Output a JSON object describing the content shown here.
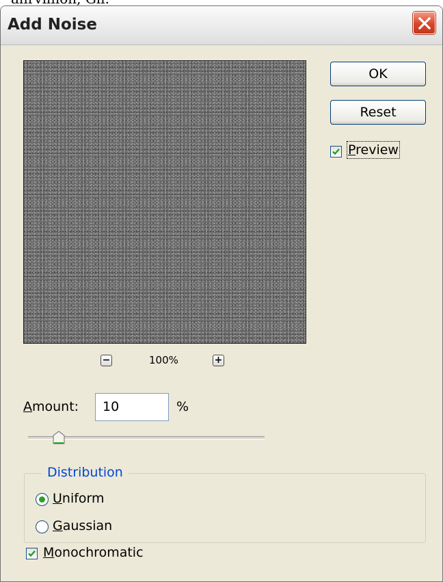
{
  "overflow_text": "anrvillion, Gll.",
  "window": {
    "title": "Add Noise"
  },
  "buttons": {
    "ok": "OK",
    "reset": "Reset"
  },
  "preview": {
    "checked": true,
    "label_first": "P",
    "label_rest": "review"
  },
  "zoom": {
    "minus": "−",
    "plus": "+",
    "level": "100%"
  },
  "amount": {
    "label_first": "A",
    "label_rest": "mount:",
    "value": "10",
    "unit": "%",
    "slider_fraction": 0.125
  },
  "distribution": {
    "legend": "Distribution",
    "options": [
      {
        "label_first": "U",
        "label_rest": "niform",
        "selected": true
      },
      {
        "label_first": "G",
        "label_rest": "aussian",
        "selected": false
      }
    ]
  },
  "monochromatic": {
    "checked": true,
    "label_first": "M",
    "label_rest": "onochromatic"
  },
  "colors": {
    "radio_dot": "#29a22a",
    "check": "#21a121",
    "legend": "#0046d5"
  }
}
